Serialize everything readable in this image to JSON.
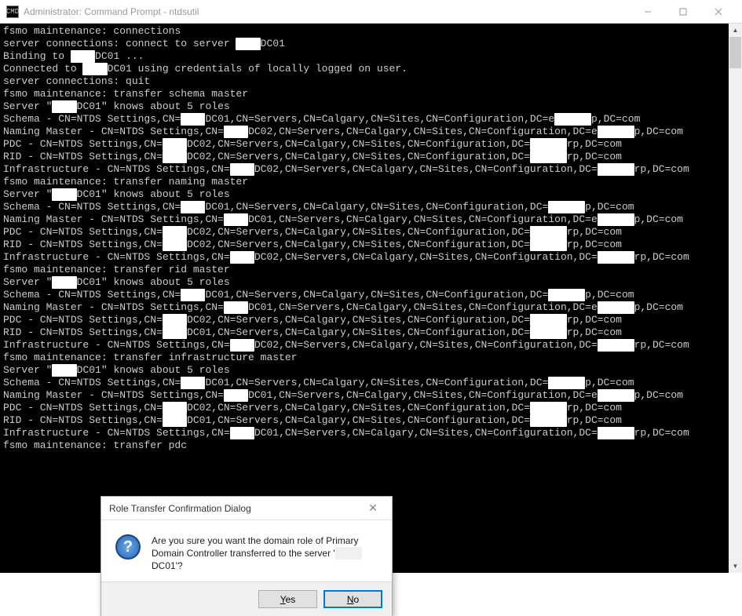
{
  "window": {
    "title": "Administrator: Command Prompt - ntdsutil",
    "icon_label": "CMD"
  },
  "terminal_lines": [
    "fsmo maintenance: connections",
    "server connections: connect to server ████DC01",
    "Binding to ████DC01 ...",
    "Connected to ████DC01 using credentials of locally logged on user.",
    "server connections: quit",
    "fsmo maintenance: transfer schema master",
    "Server \"████DC01\" knows about 5 roles",
    "Schema - CN=NTDS Settings,CN=████DC01,CN=Servers,CN=Calgary,CN=Sites,CN=Configuration,DC=e██████p,DC=com",
    "Naming Master - CN=NTDS Settings,CN=████DC02,CN=Servers,CN=Calgary,CN=Sites,CN=Configuration,DC=e██████p,DC=com",
    "PDC - CN=NTDS Settings,CN=████DC02,CN=Servers,CN=Calgary,CN=Sites,CN=Configuration,DC=██████rp,DC=com",
    "RID - CN=NTDS Settings,CN=████DC02,CN=Servers,CN=Calgary,CN=Sites,CN=Configuration,DC=██████rp,DC=com",
    "Infrastructure - CN=NTDS Settings,CN=████DC02,CN=Servers,CN=Calgary,CN=Sites,CN=Configuration,DC=██████rp,DC=com",
    "fsmo maintenance: transfer naming master",
    "Server \"████DC01\" knows about 5 roles",
    "Schema - CN=NTDS Settings,CN=████DC01,CN=Servers,CN=Calgary,CN=Sites,CN=Configuration,DC=██████p,DC=com",
    "Naming Master - CN=NTDS Settings,CN=████DC01,CN=Servers,CN=Calgary,CN=Sites,CN=Configuration,DC=e██████p,DC=com",
    "PDC - CN=NTDS Settings,CN=████DC02,CN=Servers,CN=Calgary,CN=Sites,CN=Configuration,DC=██████rp,DC=com",
    "RID - CN=NTDS Settings,CN=████DC02,CN=Servers,CN=Calgary,CN=Sites,CN=Configuration,DC=██████rp,DC=com",
    "Infrastructure - CN=NTDS Settings,CN=████DC02,CN=Servers,CN=Calgary,CN=Sites,CN=Configuration,DC=██████rp,DC=com",
    "fsmo maintenance: transfer rid master",
    "Server \"████DC01\" knows about 5 roles",
    "Schema - CN=NTDS Settings,CN=████DC01,CN=Servers,CN=Calgary,CN=Sites,CN=Configuration,DC=██████p,DC=com",
    "Naming Master - CN=NTDS Settings,CN=████DC01,CN=Servers,CN=Calgary,CN=Sites,CN=Configuration,DC=e██████p,DC=com",
    "PDC - CN=NTDS Settings,CN=████DC02,CN=Servers,CN=Calgary,CN=Sites,CN=Configuration,DC=██████rp,DC=com",
    "RID - CN=NTDS Settings,CN=████DC01,CN=Servers,CN=Calgary,CN=Sites,CN=Configuration,DC=██████rp,DC=com",
    "Infrastructure - CN=NTDS Settings,CN=████DC02,CN=Servers,CN=Calgary,CN=Sites,CN=Configuration,DC=██████rp,DC=com",
    "fsmo maintenance: transfer infrastructure master",
    "Server \"████DC01\" knows about 5 roles",
    "Schema - CN=NTDS Settings,CN=████DC01,CN=Servers,CN=Calgary,CN=Sites,CN=Configuration,DC=██████p,DC=com",
    "Naming Master - CN=NTDS Settings,CN=████DC01,CN=Servers,CN=Calgary,CN=Sites,CN=Configuration,DC=e██████p,DC=com",
    "PDC - CN=NTDS Settings,CN=████DC02,CN=Servers,CN=Calgary,CN=Sites,CN=Configuration,DC=██████rp,DC=com",
    "RID - CN=NTDS Settings,CN=████DC01,CN=Servers,CN=Calgary,CN=Sites,CN=Configuration,DC=██████rp,DC=com",
    "Infrastructure - CN=NTDS Settings,CN=████DC01,CN=Servers,CN=Calgary,CN=Sites,CN=Configuration,DC=██████rp,DC=com",
    "fsmo maintenance: transfer pdc"
  ],
  "dialog": {
    "title": "Role Transfer Confirmation Dialog",
    "message_pre": "Are you sure you want the domain role of Primary Domain Controller transferred to the server '",
    "message_redacted": "████",
    "message_post": "DC01'?",
    "yes_label": "Yes",
    "no_label": "No"
  }
}
